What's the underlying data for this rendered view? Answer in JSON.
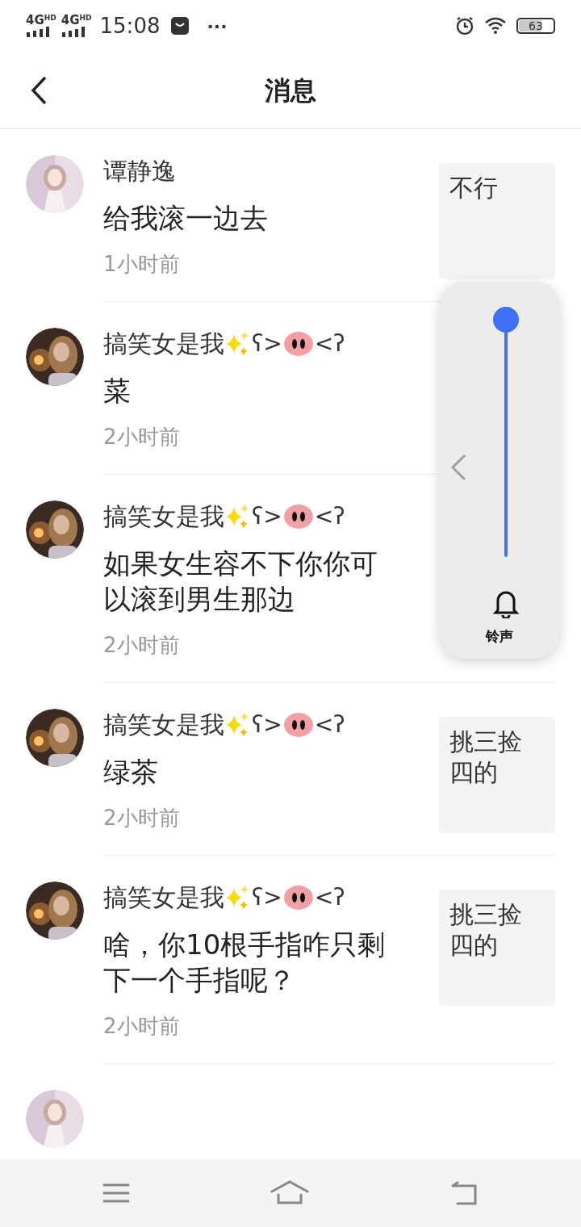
{
  "status_bar": {
    "signals": [
      {
        "label": "4G",
        "badge": "HD"
      },
      {
        "label": "4G",
        "badge": "HD"
      }
    ],
    "time": "15:08",
    "more": "···",
    "battery": "63"
  },
  "header": {
    "title": "消息"
  },
  "messages": [
    {
      "name": "谭静逸",
      "text": "给我滚一边去",
      "time": "1小时前",
      "thumb": "不行"
    },
    {
      "name": "搞笑女是我",
      "decor_left": "ʕ>",
      "decor_right": "<ʔ",
      "text": "菜",
      "time": "2小时前"
    },
    {
      "name": "搞笑女是我",
      "decor_left": "ʕ>",
      "decor_right": "<ʔ",
      "text": "如果女生容不下你你可以滚到男生那边",
      "time": "2小时前"
    },
    {
      "name": "搞笑女是我",
      "decor_left": "ʕ>",
      "decor_right": "<ʔ",
      "text": "绿茶",
      "time": "2小时前",
      "thumb": "挑三捡四的"
    },
    {
      "name": "搞笑女是我",
      "decor_left": "ʕ>",
      "decor_right": "<ʔ",
      "text": "啥，你10根手指咋只剩下一个手指呢？",
      "time": "2小时前",
      "thumb": "挑三捡四的"
    }
  ],
  "volume_panel": {
    "level": 1,
    "label": "铃声"
  }
}
